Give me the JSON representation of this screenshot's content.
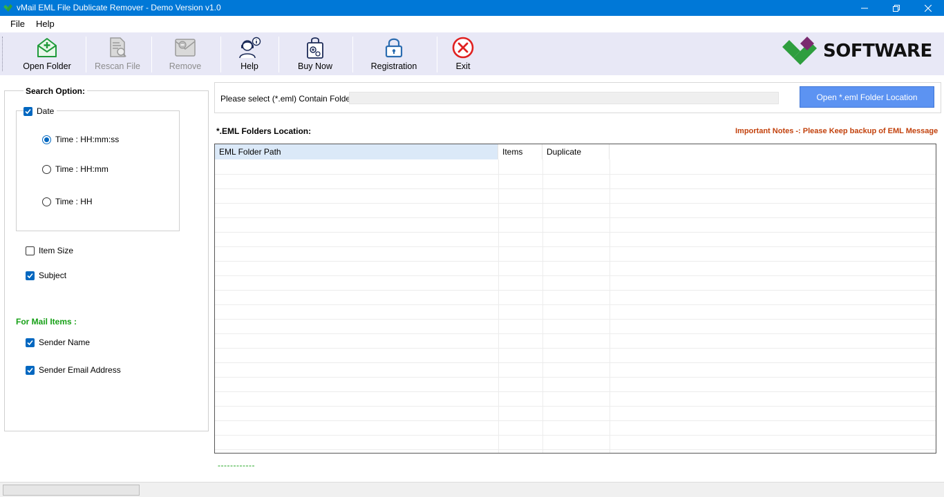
{
  "window": {
    "title": "vMail EML File Dublicate Remover - Demo Version v1.0",
    "controls": {
      "minimize": "—",
      "maximize": "❐",
      "close": "✕"
    }
  },
  "menu": [
    "File",
    "Help"
  ],
  "toolbar": {
    "open_folder": {
      "label": "Open Folder",
      "icon": "mail-open-folder-icon"
    },
    "rescan_file": {
      "label": "Rescan File",
      "icon": "rescan-file-icon",
      "enabled": false
    },
    "remove": {
      "label": "Remove",
      "icon": "remove-mail-icon",
      "enabled": false
    },
    "help": {
      "label": "Help",
      "icon": "help-support-icon"
    },
    "buy_now": {
      "label": "Buy Now",
      "icon": "shopping-bag-icon"
    },
    "registration": {
      "label": "Registration",
      "icon": "lock-icon"
    },
    "exit": {
      "label": "Exit",
      "icon": "exit-icon"
    },
    "brand": {
      "text": "SOFTWARE",
      "colors": [
        "#2e9e3e",
        "#7a2a6e"
      ]
    }
  },
  "search_options": {
    "title": "Search Option:",
    "date": {
      "label": "Date",
      "checked": true
    },
    "time_options": [
      {
        "label": "Time : HH:mm:ss",
        "selected": true
      },
      {
        "label": "Time : HH:mm",
        "selected": false
      },
      {
        "label": "Time : HH",
        "selected": false
      }
    ],
    "item_size": {
      "label": "Item Size",
      "checked": false
    },
    "subject": {
      "label": "Subject",
      "checked": true
    },
    "mail_items_title": "For Mail Items :",
    "sender_name": {
      "label": "Sender Name",
      "checked": true
    },
    "sender_email": {
      "label": "Sender Email Address",
      "checked": true
    }
  },
  "folder_select": {
    "label": "Please select (*.eml) Contain Folder :",
    "value": "",
    "button": "Open *.eml Folder Location"
  },
  "folders_heading": "*.EML Folders Location:",
  "notes": "Important Notes -:  Please Keep backup of EML Message",
  "grid": {
    "columns": [
      "EML Folder Path",
      "Items",
      "Duplicate"
    ],
    "rows": []
  },
  "status_dashes": "------------",
  "progress": 0,
  "colors": {
    "title_bar": "#0078d7",
    "toolbar_bg": "#e8e8f6",
    "accent_button": "#5c93f2",
    "green_label": "#16a016",
    "notes": "#c2410c"
  }
}
